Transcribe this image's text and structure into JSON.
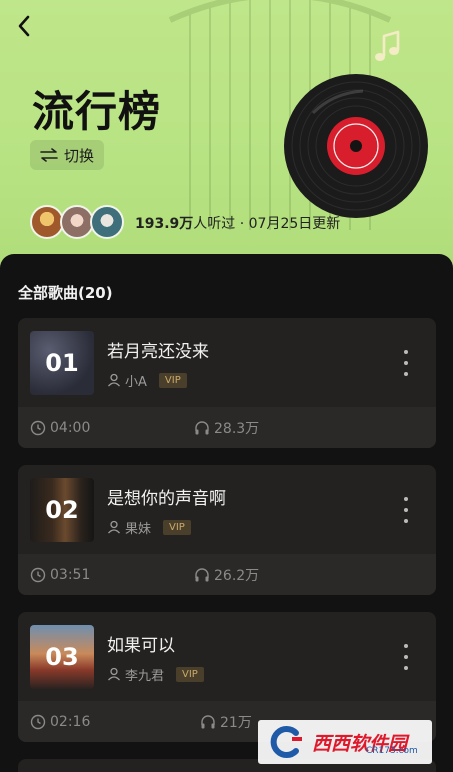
{
  "header": {
    "title": "流行榜",
    "switch_label": "切换",
    "listen_count": "193.9万",
    "listen_suffix": "人听过 · 07月25日更新"
  },
  "list": {
    "title": "全部歌曲(20)"
  },
  "songs": [
    {
      "rank": "01",
      "name": "若月亮还没来",
      "artist": "小A",
      "badge": "VIP",
      "duration": "04:00",
      "plays": "28.3万"
    },
    {
      "rank": "02",
      "name": "是想你的声音啊",
      "artist": "果妹",
      "badge": "VIP",
      "duration": "03:51",
      "plays": "26.2万"
    },
    {
      "rank": "03",
      "name": "如果可以",
      "artist": "李九君",
      "badge": "VIP",
      "duration": "02:16",
      "plays": "21万"
    }
  ],
  "watermark": {
    "text": "西西软件园",
    "sub": "CR173.com"
  },
  "colors": {
    "header_bg": "#b8e383",
    "panel_bg": "#121212",
    "card_bg": "#242220",
    "vip_text": "#c9a96b",
    "vinyl_label": "#d81e2c"
  },
  "icons": [
    "back-icon",
    "switch-arrows-icon",
    "vinyl-record-icon",
    "music-note-icon",
    "user-icon",
    "clock-icon",
    "headphones-icon",
    "more-vertical-icon"
  ]
}
